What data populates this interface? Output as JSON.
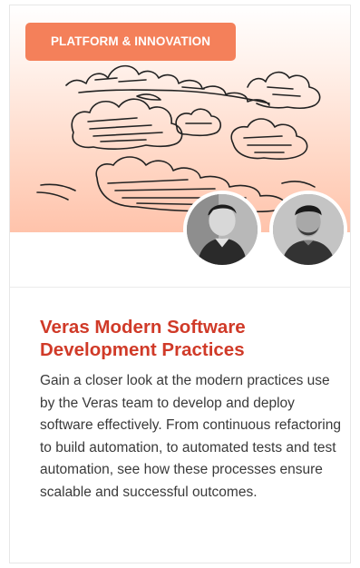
{
  "card": {
    "category": "PLATFORM & INNOVATION",
    "title": "Veras Modern Software Development Practices",
    "description": "Gain a closer look at the modern practices use by the Veras team to develop and deploy software effectively. From continuous refactoring to build automation, to automated tests and test automation, see how these processes ensure scalable and successful outcomes.",
    "illustration": "hand-drawn-clouds",
    "speakers": [
      {
        "icon": "speaker-photo-1"
      },
      {
        "icon": "speaker-photo-2"
      }
    ]
  },
  "colors": {
    "badge_background": "#f4805a",
    "title_text": "#d03a28",
    "hero_gradient_bottom": "#ffc3ab",
    "body_text": "#3a3a3a"
  }
}
